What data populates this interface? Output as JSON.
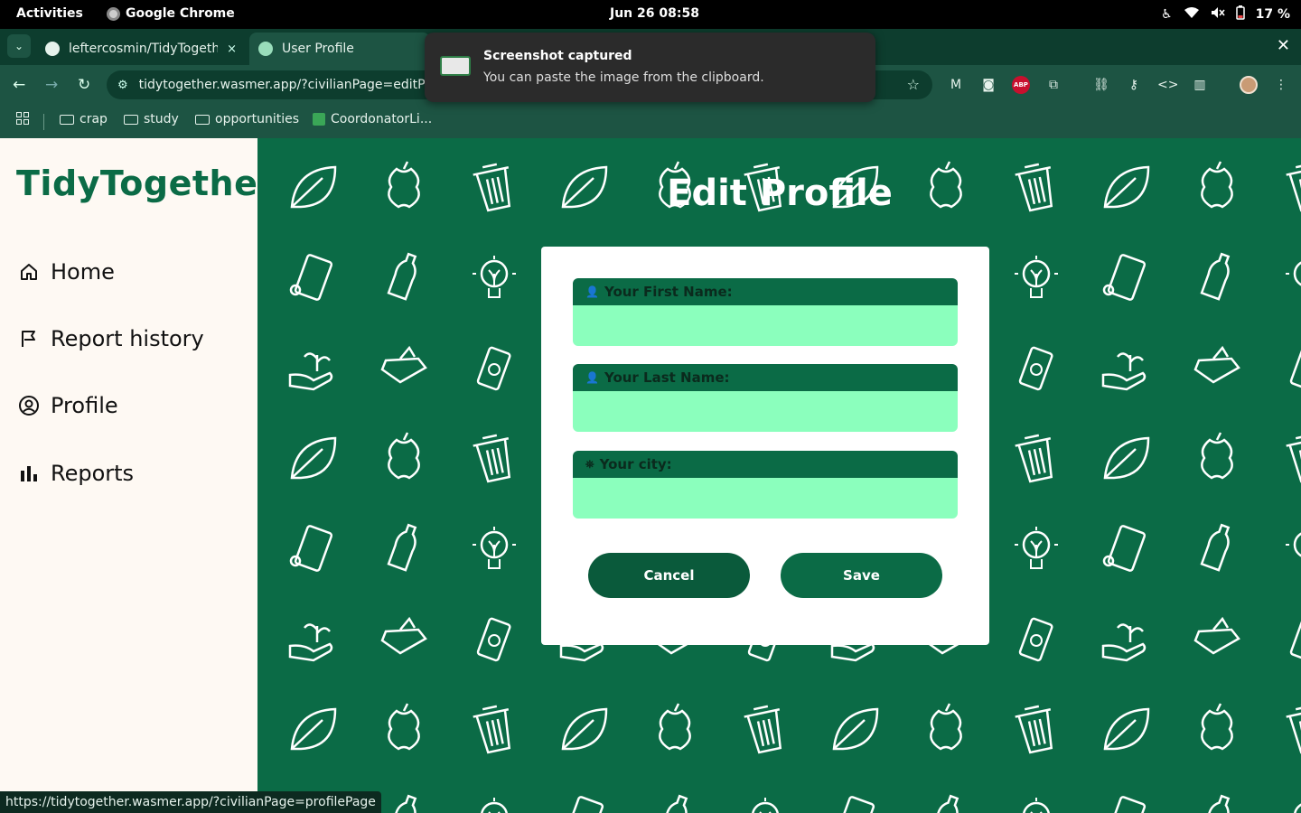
{
  "topbar": {
    "activities": "Activities",
    "app_name": "Google Chrome",
    "clock": "Jun 26  08:58",
    "battery": "17 %"
  },
  "tabs": [
    {
      "title": "leftercosmin/TidyTogeth",
      "close": "×"
    },
    {
      "title": "User Profile"
    }
  ],
  "toolbar": {
    "url": "tidytogether.wasmer.app/?civilianPage=editProfileP",
    "abp_label": "ABP"
  },
  "bookmarks": [
    {
      "label": "crap"
    },
    {
      "label": "study"
    },
    {
      "label": "opportunities"
    },
    {
      "label": "CoordonatorLi..."
    }
  ],
  "sidebar": {
    "brand": "TidyTogether",
    "items": [
      {
        "label": "Home",
        "icon": "home-icon"
      },
      {
        "label": "Report history",
        "icon": "flag-icon"
      },
      {
        "label": "Profile",
        "icon": "user-circle-icon"
      },
      {
        "label": "Reports",
        "icon": "bar-chart-icon"
      }
    ]
  },
  "main": {
    "title": "Edit Profile",
    "fields": [
      {
        "label": "Your First Name:",
        "value": "",
        "icon": "person-icon"
      },
      {
        "label": "Your Last Name:",
        "value": "",
        "icon": "person-icon"
      },
      {
        "label": "Your city:",
        "value": "",
        "icon": "location-person-icon"
      }
    ],
    "cancel_label": "Cancel",
    "save_label": "Save"
  },
  "notification": {
    "title": "Screenshot captured",
    "body": "You can paste the image from the clipboard."
  },
  "status_url": "https://tidytogether.wasmer.app/?civilianPage=profilePage",
  "colors": {
    "brand_green": "#0b6b46",
    "input_mint": "#8bffbd",
    "sidebar_bg": "#fef9f3"
  }
}
